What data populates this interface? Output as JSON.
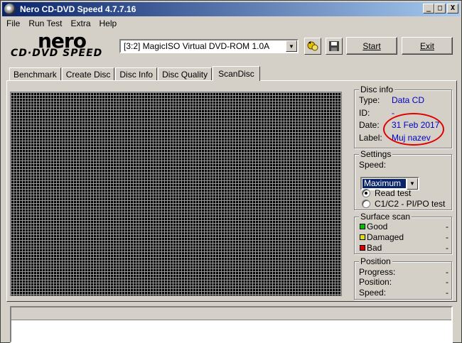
{
  "window": {
    "title": "Nero CD-DVD Speed 4.7.7.16"
  },
  "title_buttons": {
    "minimize": "_",
    "maximize": "□",
    "close": "X"
  },
  "menu": [
    {
      "label": "File",
      "underline": "F"
    },
    {
      "label": "Run Test",
      "underline": "R"
    },
    {
      "label": "Extra",
      "underline": "E"
    },
    {
      "label": "Help",
      "underline": "H"
    }
  ],
  "logo": {
    "top": "nero",
    "bottom": "CD·DVD SPEED"
  },
  "toolbar": {
    "drive": "[3:2]  MagicISO Virtual DVD-ROM 1.0A",
    "start_label": "Start",
    "exit_label": "Exit",
    "icons": [
      "refresh-icon",
      "save-icon"
    ]
  },
  "tabs": [
    {
      "label": "Benchmark",
      "active": false
    },
    {
      "label": "Create Disc",
      "active": false
    },
    {
      "label": "Disc Info",
      "active": false
    },
    {
      "label": "Disc Quality",
      "active": false
    },
    {
      "label": "ScanDisc",
      "active": true
    }
  ],
  "disc_info": {
    "title": "Disc info",
    "type_label": "Type:",
    "type_value": "Data CD",
    "id_label": "ID:",
    "id_value": "-",
    "date_label": "Date:",
    "date_value": "31 Feb 2017",
    "label_label": "Label:",
    "label_value": "Muj nazev"
  },
  "settings": {
    "title": "Settings",
    "speed_label": "Speed:",
    "speed_value": "Maximum",
    "option1": "Read test",
    "option2": "C1/C2 - PI/PO test",
    "selected": "Read test"
  },
  "surface_scan": {
    "title": "Surface scan",
    "items": [
      {
        "label": "Good",
        "value": "-",
        "color": "#00c000"
      },
      {
        "label": "Damaged",
        "value": "-",
        "color": "#e0e000"
      },
      {
        "label": "Bad",
        "value": "-",
        "color": "#e00000"
      }
    ]
  },
  "position": {
    "title": "Position",
    "progress_label": "Progress:",
    "progress_value": "-",
    "position_label": "Position:",
    "position_value": "-",
    "speed_label": "Speed:",
    "speed_value": "-"
  },
  "colors": {
    "accent_blue": "#0000c0",
    "highlight_red": "#e00000",
    "titlebar": "#0a246a"
  }
}
